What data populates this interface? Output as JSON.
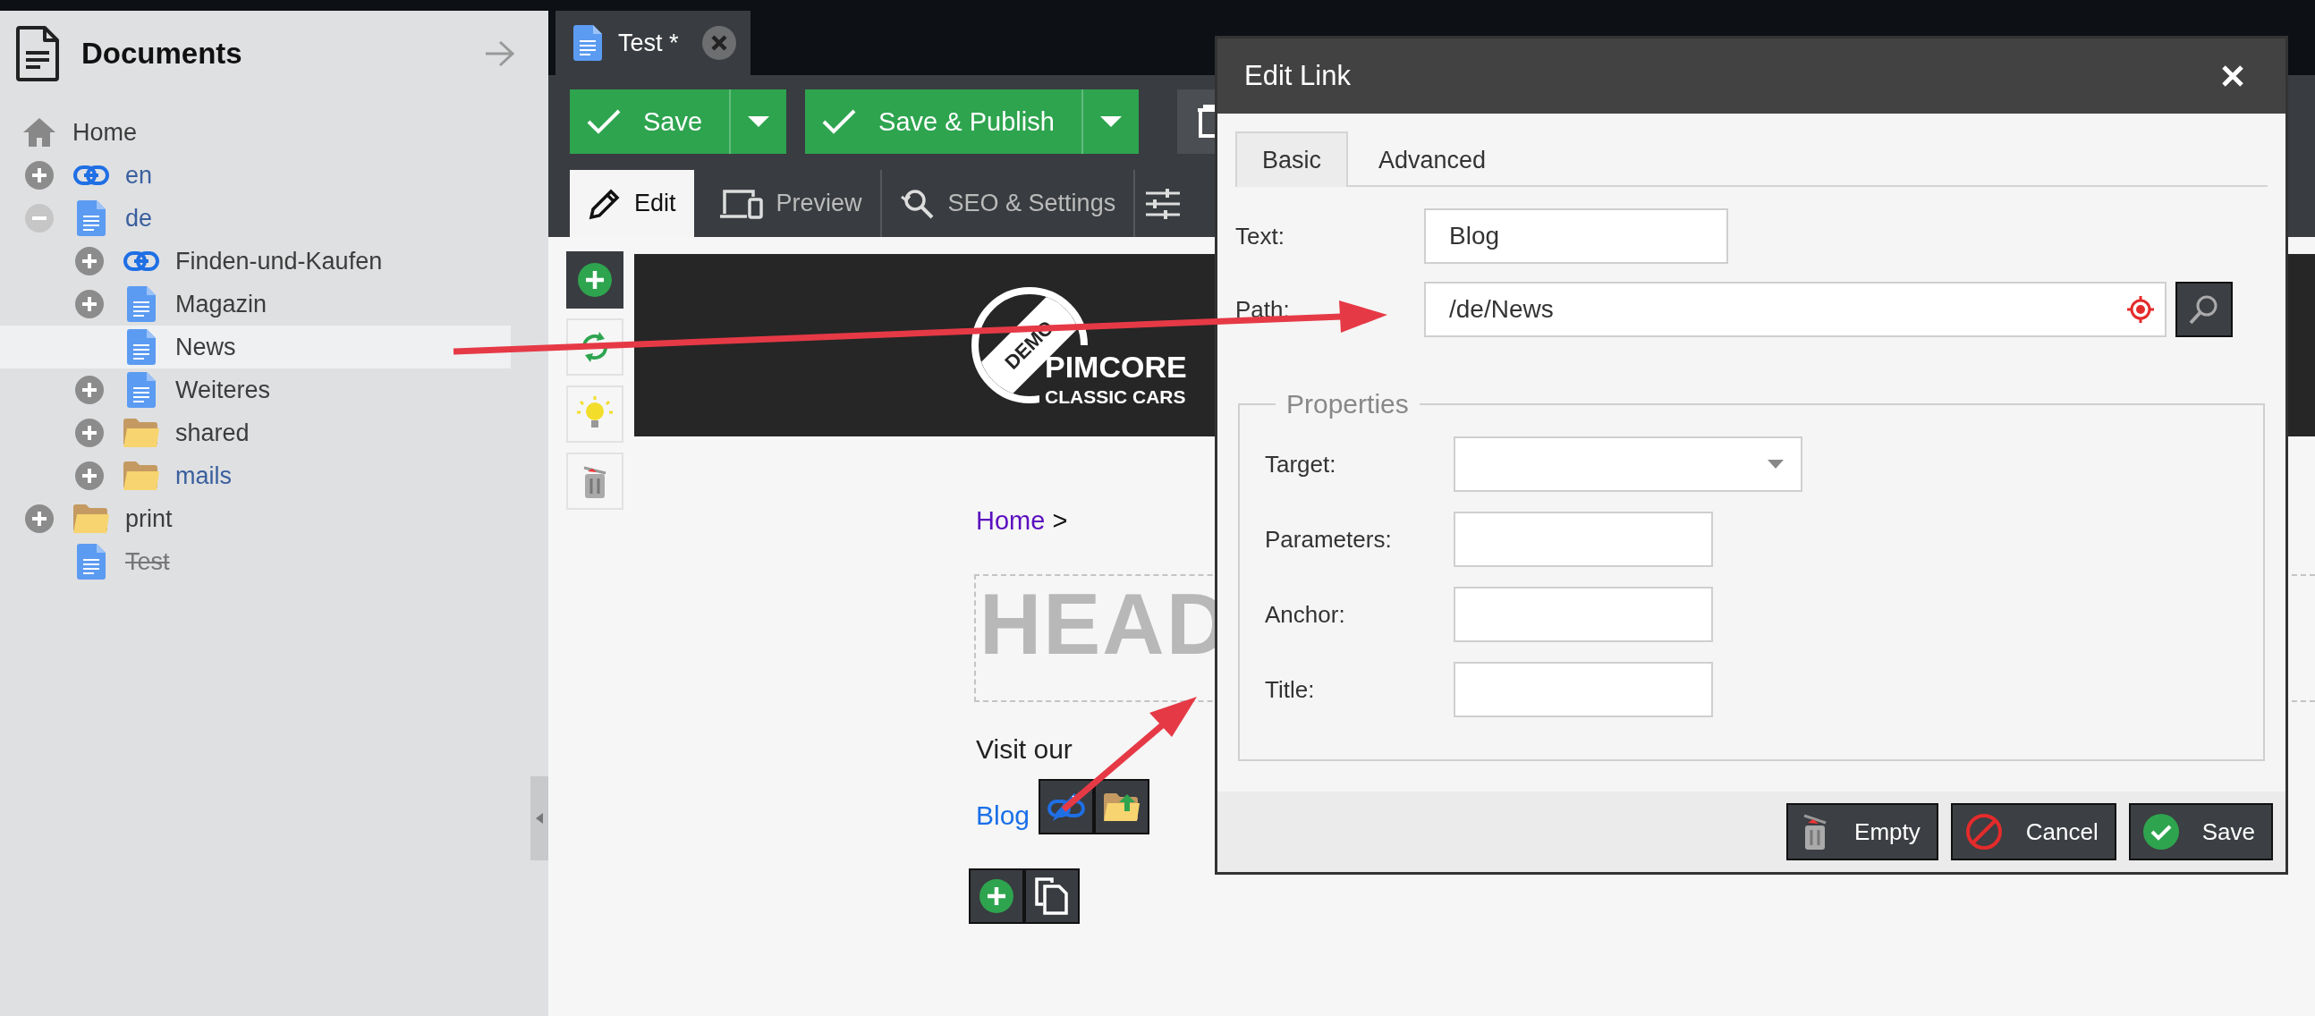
{
  "sidebar": {
    "title": "Documents",
    "root": {
      "label": "Home",
      "selected": false,
      "children": [
        {
          "label": "en",
          "kind": "link",
          "expanded": false,
          "selected": false,
          "site": true,
          "unpublished": false
        },
        {
          "label": "de",
          "kind": "page",
          "expanded": true,
          "selected": false,
          "site": true,
          "unpublished": false,
          "children": [
            {
              "label": "Finden-und-Kaufen",
              "kind": "link",
              "expanded": false,
              "selected": false,
              "site": false,
              "unpublished": false
            },
            {
              "label": "Magazin",
              "kind": "page",
              "expanded": false,
              "selected": false,
              "site": false,
              "unpublished": false
            },
            {
              "label": "News",
              "kind": "page",
              "selected": true,
              "site": false,
              "unpublished": false
            },
            {
              "label": "Weiteres",
              "kind": "page",
              "expanded": false,
              "selected": false,
              "site": false,
              "unpublished": false
            },
            {
              "label": "shared",
              "kind": "folder",
              "expanded": false,
              "selected": false,
              "site": false,
              "unpublished": false
            },
            {
              "label": "mails",
              "kind": "folder",
              "expanded": false,
              "selected": false,
              "site": true,
              "unpublished": false
            }
          ]
        },
        {
          "label": "print",
          "kind": "folder",
          "expanded": false,
          "selected": false,
          "site": false,
          "unpublished": false
        },
        {
          "label": "Test",
          "kind": "page",
          "selected": false,
          "site": false,
          "unpublished": true
        }
      ]
    }
  },
  "editor": {
    "tab": {
      "label": "Test *"
    },
    "buttons": [
      {
        "label": "Save"
      },
      {
        "label": "Save & Publish"
      }
    ],
    "tabs": [
      {
        "label": "Edit",
        "kind": "pencil",
        "selected": true
      },
      {
        "label": "Preview",
        "kind": "devices",
        "selected": false
      },
      {
        "label": "SEO & Settings",
        "kind": "seo",
        "selected": false
      }
    ]
  },
  "page": {
    "logo": {
      "badge": "DEMO",
      "name": "PIMCORE",
      "tagline": "CLASSIC CARS"
    },
    "breadcrumb": {
      "link": "Home",
      "separator": ">"
    },
    "headline": "HEAD",
    "text": "Visit our",
    "link": "Blog"
  },
  "dialog": {
    "title": "Edit Link",
    "tabs": [
      {
        "label": "Basic",
        "selected": true
      },
      {
        "label": "Advanced",
        "selected": false
      }
    ],
    "fields": [
      {
        "label": "Text:",
        "kind": "text",
        "value": "Blog"
      },
      {
        "label": "Path:",
        "kind": "path",
        "value": "/de/News"
      }
    ],
    "properties": {
      "legend": "Properties",
      "fields": [
        {
          "label": "Target:",
          "kind": "select"
        },
        {
          "label": "Parameters:",
          "kind": "text"
        },
        {
          "label": "Anchor:",
          "kind": "text"
        },
        {
          "label": "Title:",
          "kind": "text"
        }
      ]
    },
    "buttons": [
      {
        "label": "Empty",
        "kind": "trash"
      },
      {
        "label": "Cancel",
        "kind": "cancel"
      },
      {
        "label": "Save",
        "kind": "check"
      }
    ]
  }
}
